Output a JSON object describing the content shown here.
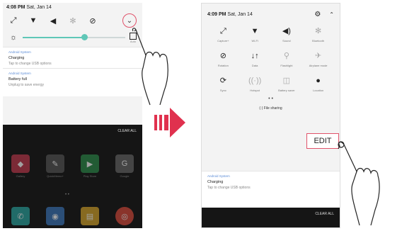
{
  "left": {
    "time": "4:08 PM",
    "date": "Sat, Jan 14",
    "quick_icons": [
      "expand-icon",
      "wifi-icon",
      "volume-icon",
      "bluetooth-icon",
      "rotation-icon"
    ],
    "brightness_auto": "Auto",
    "brightness_level": 0.6,
    "notifications": [
      {
        "source": "Android System",
        "title": "Charging",
        "subtitle": "Tap to change USB options"
      },
      {
        "source": "Android System",
        "title": "Battery full",
        "subtitle": "Unplug to save energy"
      }
    ],
    "clear_all": "CLEAR ALL",
    "apps_row1": [
      {
        "label": "Gallery",
        "color": "#c0394d"
      },
      {
        "label": "QuickMemo+",
        "color": "#555"
      },
      {
        "label": "Play Store",
        "color": "#2b8a4a"
      },
      {
        "label": "Google",
        "color": "#666"
      }
    ],
    "apps_row2": [
      {
        "label": "",
        "color": "#2aa5a0"
      },
      {
        "label": "",
        "color": "#3a74b8"
      },
      {
        "label": "",
        "color": "#d3a32a"
      },
      {
        "label": "",
        "color": "#d9493b"
      }
    ]
  },
  "right": {
    "time": "4:09 PM",
    "date": "Sat, Jan 14",
    "tiles": [
      {
        "icon": "⤢",
        "label": "Capture+",
        "on": true
      },
      {
        "icon": "▼",
        "label": "Wi-Fi",
        "on": true
      },
      {
        "icon": "◀)",
        "label": "Sound",
        "on": true
      },
      {
        "icon": "✻",
        "label": "Bluetooth",
        "on": false
      },
      {
        "icon": "⊘",
        "label": "Rotation",
        "on": true
      },
      {
        "icon": "↓↑",
        "label": "Data",
        "on": true
      },
      {
        "icon": "⚲",
        "label": "Flashlight",
        "on": false
      },
      {
        "icon": "✈",
        "label": "Airplane mode",
        "on": false
      },
      {
        "icon": "⟳",
        "label": "Sync",
        "on": true
      },
      {
        "icon": "((·))",
        "label": "Hotspot",
        "on": false
      },
      {
        "icon": "◫",
        "label": "Battery saver",
        "on": false
      },
      {
        "icon": "●",
        "label": "Location",
        "on": true
      }
    ],
    "file_sharing": "(·) File sharing",
    "notification": {
      "source": "Android System",
      "title": "Charging",
      "subtitle": "Tap to change USB options"
    },
    "clear_all": "CLEAR ALL",
    "edit_label": "EDIT"
  },
  "colors": {
    "accent": "#e0526a",
    "slider": "#5fc7b7",
    "link": "#5a8bd6"
  }
}
